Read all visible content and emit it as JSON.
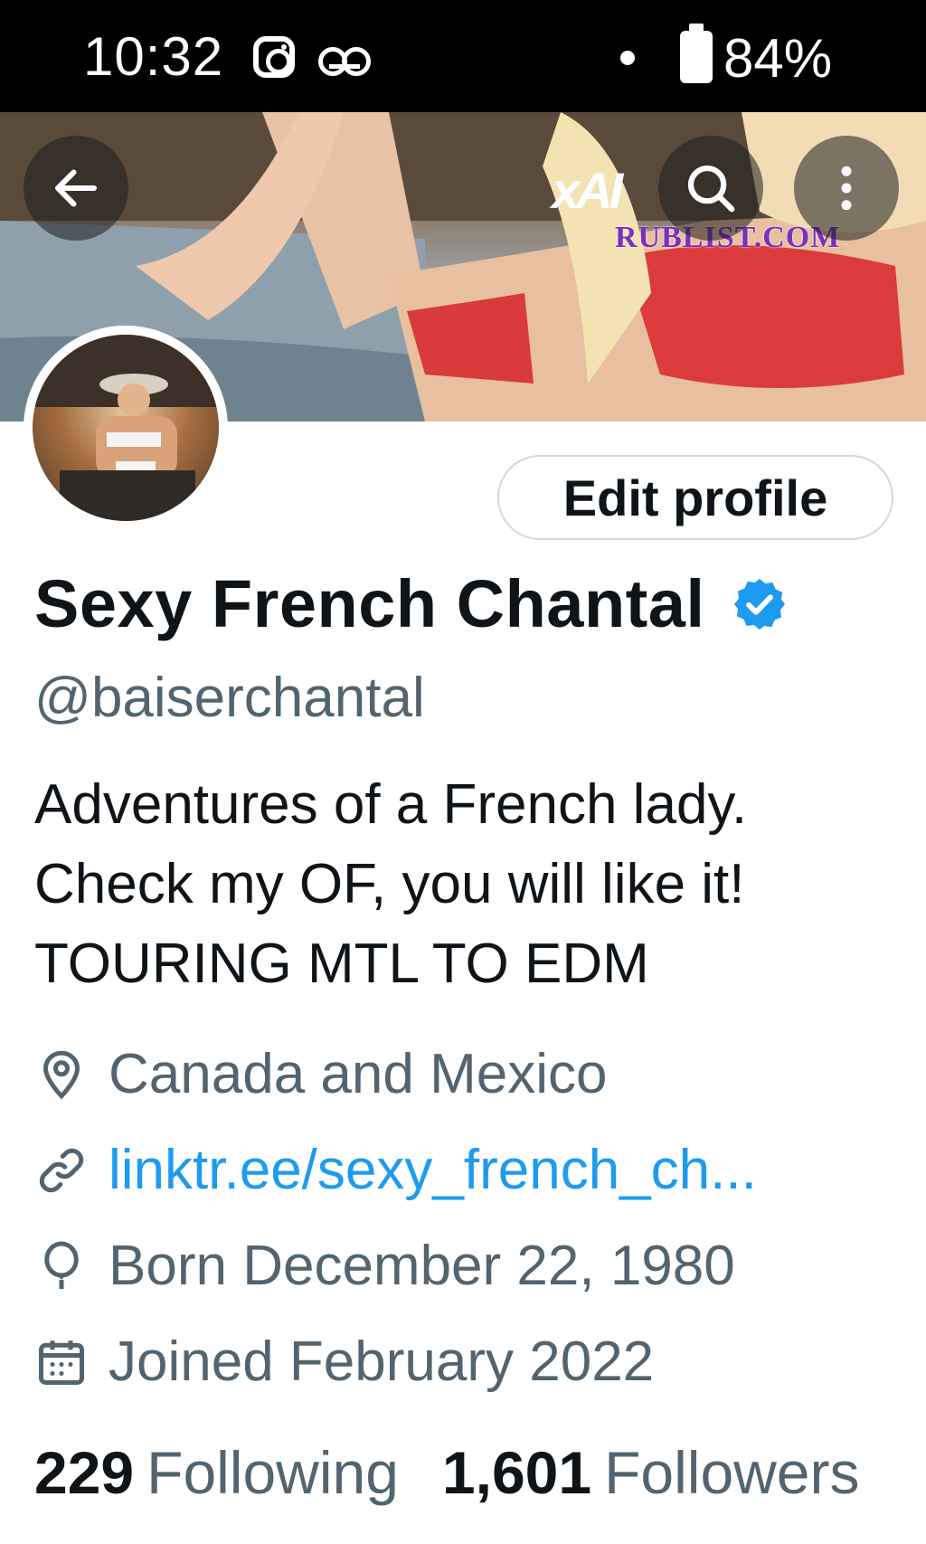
{
  "status_bar": {
    "time": "10:32",
    "battery": "84%"
  },
  "banner": {
    "watermark": "RUBLIST.COM"
  },
  "header": {
    "back_icon": "arrow-left-icon",
    "grok_logo": "xAI",
    "search_icon": "search-icon",
    "more_icon": "more-vertical-icon"
  },
  "profile": {
    "edit_label": "Edit profile",
    "display_name": "Sexy French Chantal",
    "verified": true,
    "handle": "@baiserchantal",
    "bio": [
      "Adventures of a French lady.",
      "Check my OF, you will like it!",
      "TOURING MTL TO EDM"
    ],
    "location": "Canada and Mexico",
    "link": "linktr.ee/sexy_french_ch...",
    "born": "Born December 22, 1980",
    "joined": "Joined February 2022",
    "following_count": "229",
    "following_label": "Following",
    "followers_count": "1,601",
    "followers_label": "Followers"
  },
  "colors": {
    "accent": "#1d9bf0",
    "secondary_text": "#536471",
    "primary_text": "#0f1419"
  }
}
